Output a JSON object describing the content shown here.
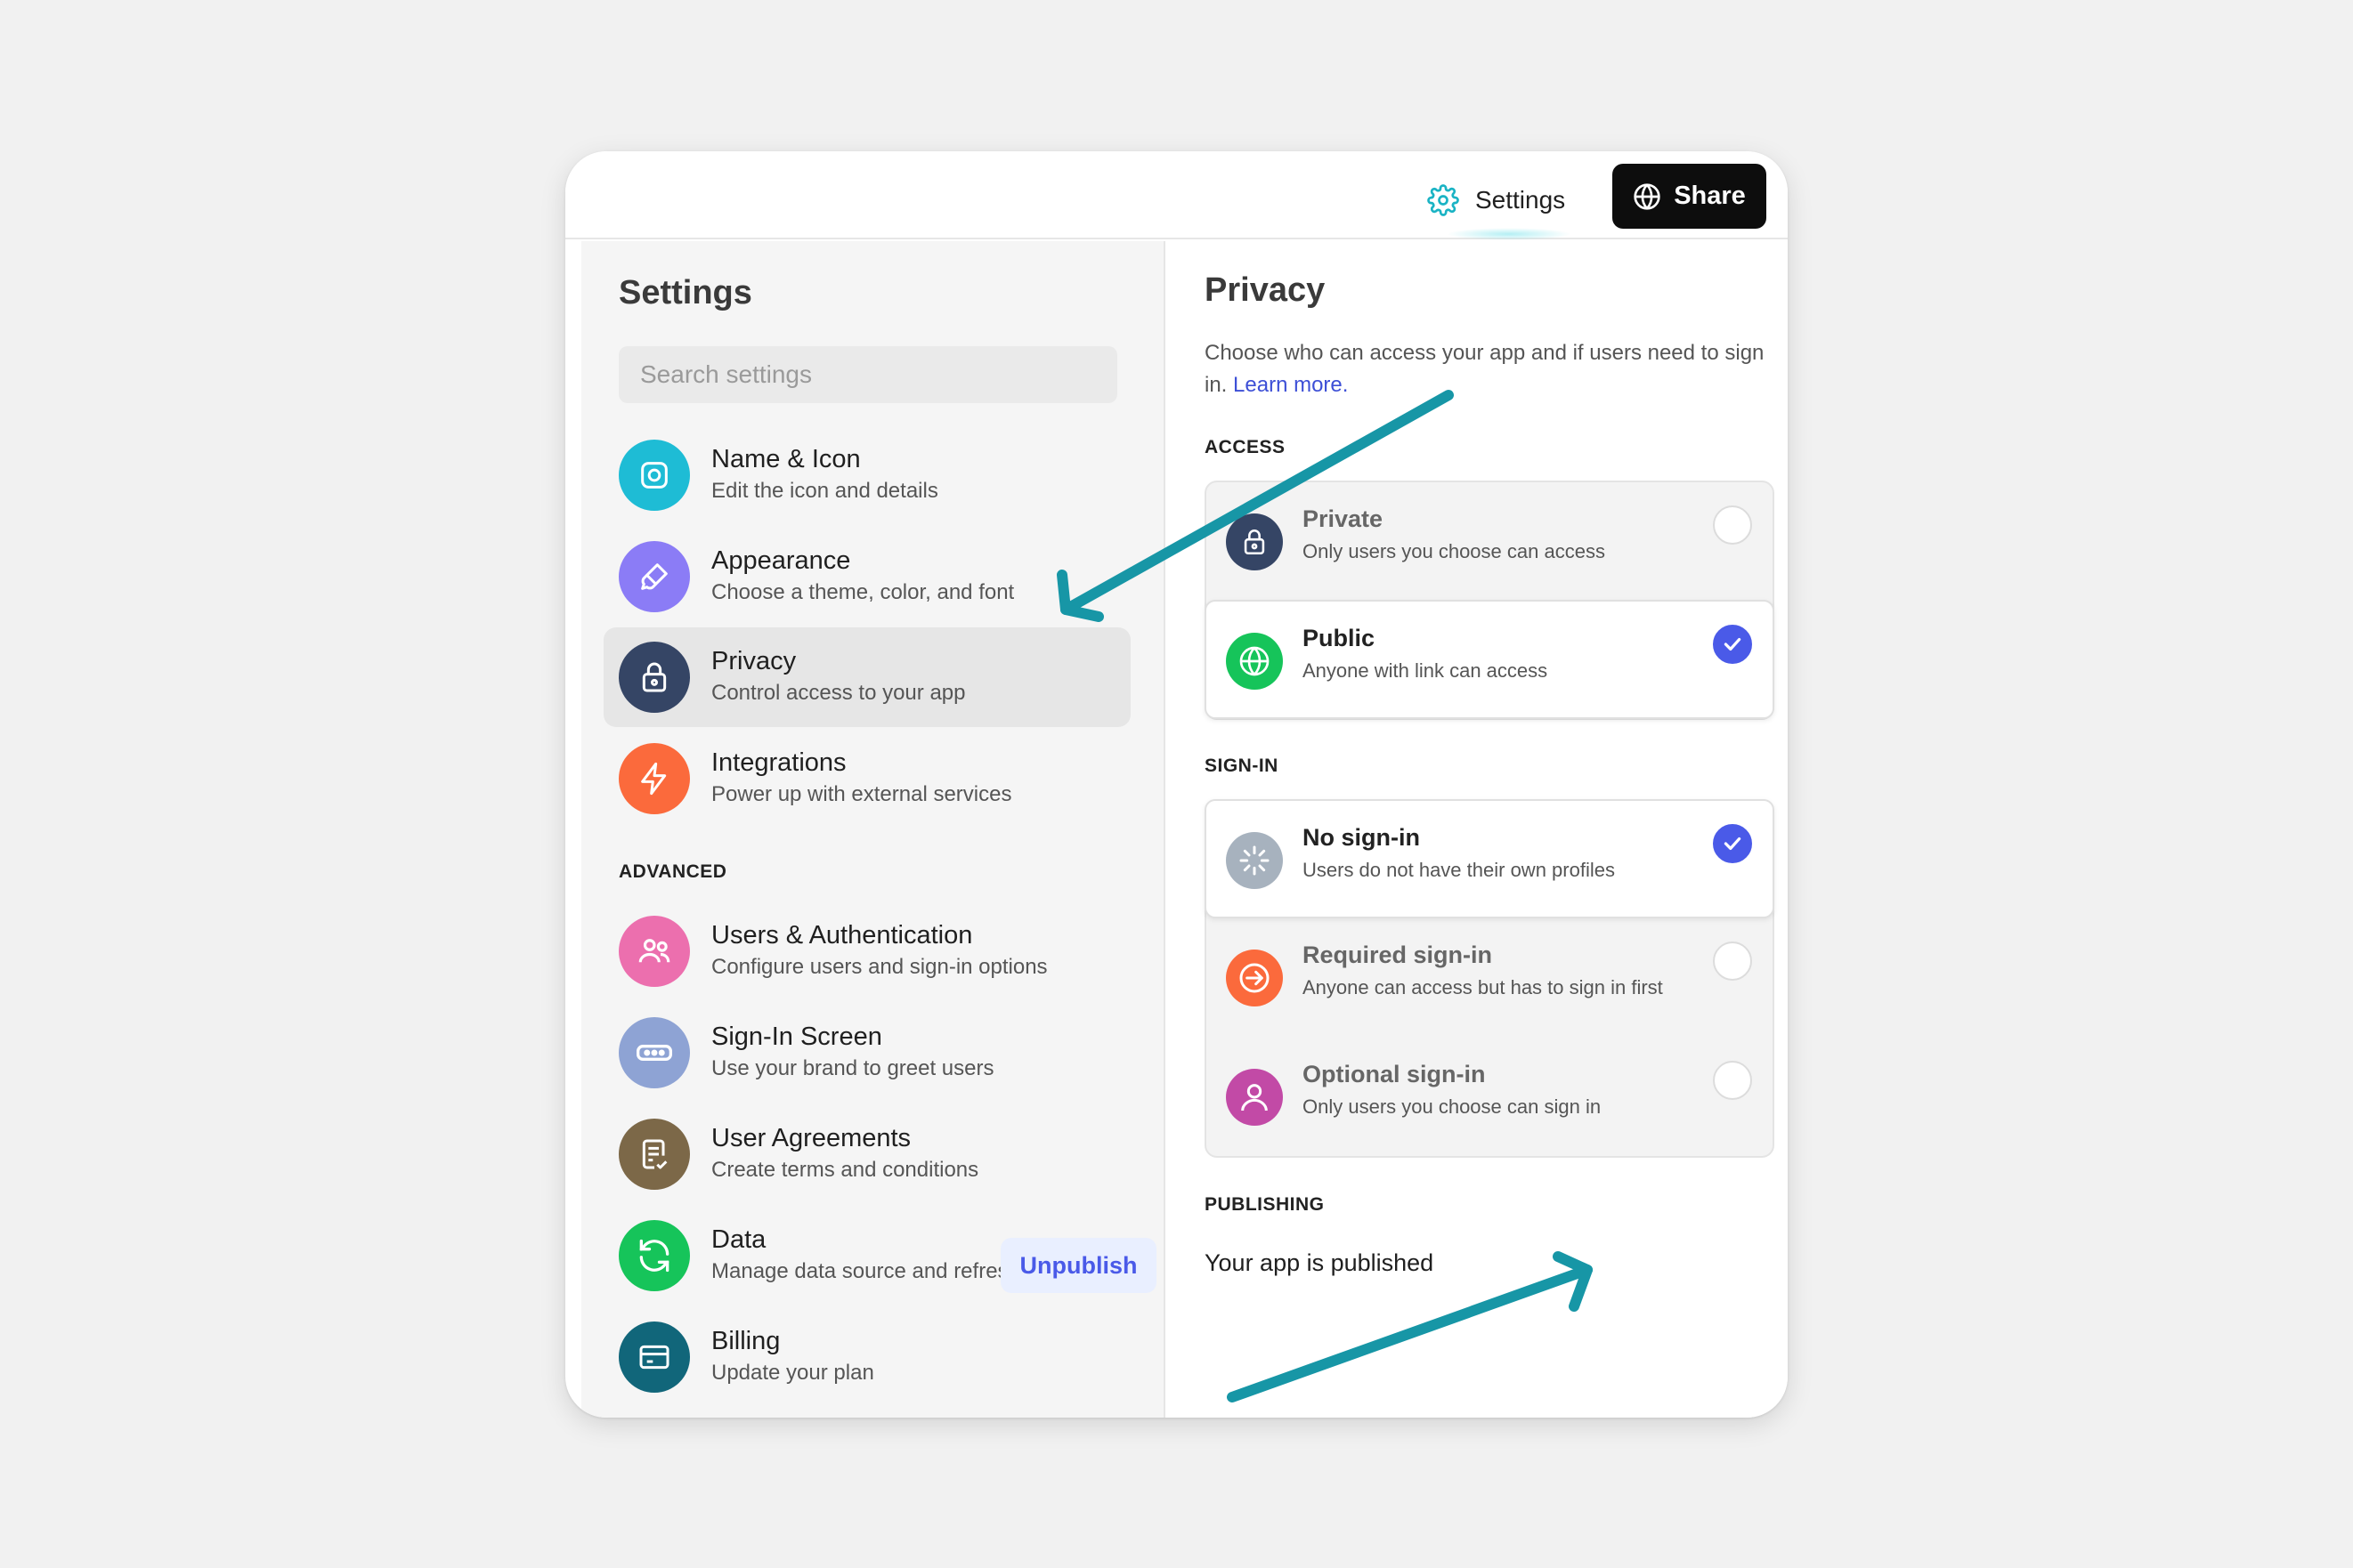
{
  "topbar": {
    "settings_label": "Settings",
    "share_label": "Share"
  },
  "sidebar": {
    "title": "Settings",
    "search_placeholder": "Search settings",
    "items": [
      {
        "title": "Name & Icon",
        "subtitle": "Edit the icon and details",
        "icon": "instagram-icon",
        "color": "#1ebcd5"
      },
      {
        "title": "Appearance",
        "subtitle": "Choose a theme, color, and font",
        "icon": "brush-icon",
        "color": "#8b7cf6"
      },
      {
        "title": "Privacy",
        "subtitle": "Control access to your app",
        "icon": "lock-icon",
        "color": "#354565"
      },
      {
        "title": "Integrations",
        "subtitle": "Power up with external services",
        "icon": "bolt-icon",
        "color": "#fb6a3c"
      }
    ],
    "advanced_label": "ADVANCED",
    "advanced_items": [
      {
        "title": "Users & Authentication",
        "subtitle": "Configure users and sign-in options",
        "icon": "users-icon",
        "color": "#ec6fae"
      },
      {
        "title": "Sign-In Screen",
        "subtitle": "Use your brand to greet users",
        "icon": "password-icon",
        "color": "#8ea3d4"
      },
      {
        "title": "User Agreements",
        "subtitle": "Create terms and conditions",
        "icon": "document-check-icon",
        "color": "#7c6848"
      },
      {
        "title": "Data",
        "subtitle": "Manage data source and refresh",
        "icon": "refresh-icon",
        "color": "#16c45a"
      },
      {
        "title": "Billing",
        "subtitle": "Update your plan",
        "icon": "credit-card-icon",
        "color": "#11667a"
      }
    ]
  },
  "main": {
    "title": "Privacy",
    "description": "Choose who can access your app and if users need to sign in.",
    "learn_more": "Learn more.",
    "access_label": "ACCESS",
    "access_options": [
      {
        "title": "Private",
        "subtitle": "Only users you choose can access",
        "icon": "lock-icon",
        "color": "#354565",
        "selected": false
      },
      {
        "title": "Public",
        "subtitle": "Anyone with link can access",
        "icon": "globe-icon",
        "color": "#16c45a",
        "selected": true
      }
    ],
    "signin_label": "SIGN-IN",
    "signin_options": [
      {
        "title": "No sign-in",
        "subtitle": "Users do not have their own profiles",
        "icon": "loader-icon",
        "color": "#a7b2be",
        "selected": true
      },
      {
        "title": "Required sign-in",
        "subtitle": "Anyone can access but has to sign in first",
        "icon": "sign-in-icon",
        "color": "#fb6a3c",
        "selected": false
      },
      {
        "title": "Optional sign-in",
        "subtitle": "Only users you choose can sign in",
        "icon": "user-icon",
        "color": "#c24aa6",
        "selected": false
      }
    ],
    "publishing_label": "PUBLISHING",
    "published_text": "Your app is published",
    "unpublish_label": "Unpublish"
  },
  "colors": {
    "accent": "#4a5ae8",
    "annotation_arrow": "#1796a6",
    "share_bg": "#0d0d0d"
  }
}
